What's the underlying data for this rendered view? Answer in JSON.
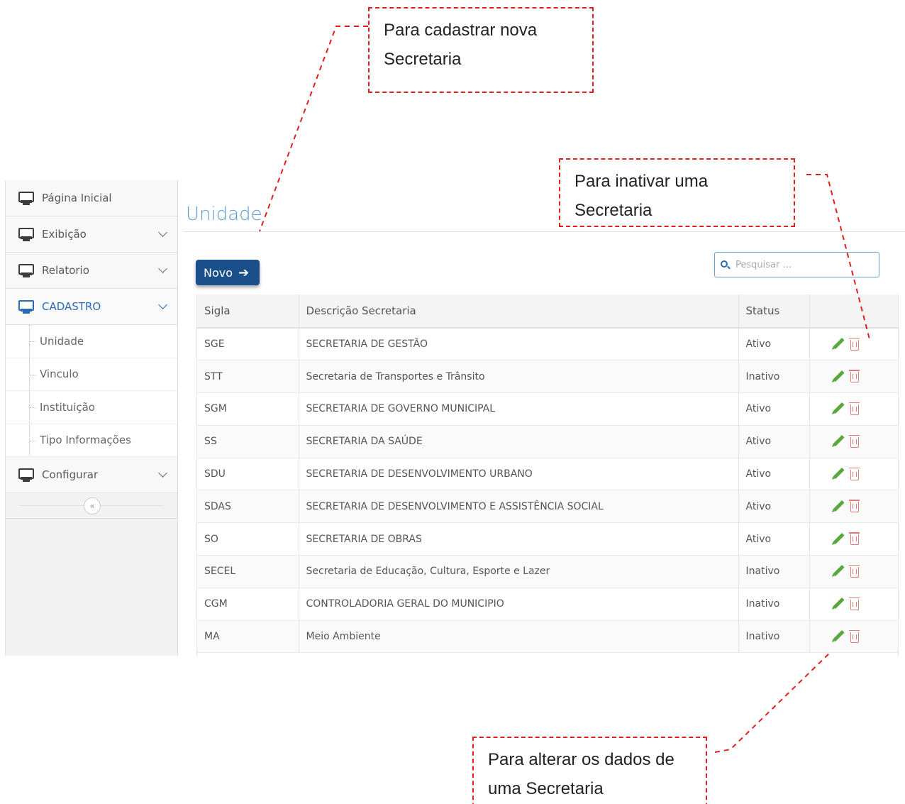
{
  "sidebar": {
    "items": [
      {
        "label": "Página Inicial"
      },
      {
        "label": "Exibição"
      },
      {
        "label": "Relatorio"
      },
      {
        "label": "CADASTRO"
      },
      {
        "label": "Configurar"
      }
    ],
    "submenu": [
      {
        "label": "Unidade"
      },
      {
        "label": "Vinculo"
      },
      {
        "label": "Instituição"
      },
      {
        "label": "Tipo Informações"
      }
    ],
    "collapse_glyph": "«"
  },
  "main": {
    "title": "Unidade",
    "new_button": "Novo",
    "search_placeholder": "Pesquisar ..."
  },
  "table": {
    "headers": [
      "Sigla",
      "Descrição Secretaria",
      "Status",
      ""
    ],
    "rows": [
      {
        "sigla": "SGE",
        "descricao": "SECRETARIA DE GESTÃO",
        "status": "Ativo"
      },
      {
        "sigla": "STT",
        "descricao": "Secretaria de Transportes e Trânsito",
        "status": "Inativo"
      },
      {
        "sigla": "SGM",
        "descricao": "SECRETARIA DE GOVERNO MUNICIPAL",
        "status": "Ativo"
      },
      {
        "sigla": "SS",
        "descricao": "SECRETARIA DA SAÚDE",
        "status": "Ativo"
      },
      {
        "sigla": "SDU",
        "descricao": "SECRETARIA DE DESENVOLVIMENTO URBANO",
        "status": "Ativo"
      },
      {
        "sigla": "SDAS",
        "descricao": "SECRETARIA DE DESENVOLVIMENTO E ASSISTÊNCIA SOCIAL",
        "status": "Ativo"
      },
      {
        "sigla": "SO",
        "descricao": "SECRETARIA DE OBRAS",
        "status": "Ativo"
      },
      {
        "sigla": "SECEL",
        "descricao": "Secretaria de Educação, Cultura, Esporte e Lazer",
        "status": "Inativo"
      },
      {
        "sigla": "CGM",
        "descricao": "CONTROLADORIA GERAL DO MUNICIPIO",
        "status": "Inativo"
      },
      {
        "sigla": "MA",
        "descricao": "Meio Ambiente",
        "status": "Inativo"
      }
    ]
  },
  "callouts": {
    "new": {
      "line1": "Para cadastrar nova",
      "line2": "Secretaria"
    },
    "inactivate": {
      "line1": "Para inativar uma",
      "line2": "Secretaria"
    },
    "edit": {
      "line1": "Para alterar os dados de",
      "line2": "uma Secretaria"
    }
  },
  "colors": {
    "accent": "#2a6cb6",
    "button": "#1b4f8c",
    "title": "#5b9bd5",
    "edit_icon": "#58a83e",
    "delete_icon": "#e27a7a",
    "callout_border": "#e0201e"
  },
  "icons": {
    "nav": "monitor-icon",
    "expand": "chevron-down-icon",
    "search": "search-icon",
    "edit": "pencil-icon",
    "delete": "trash-icon",
    "new_arrow": "arrow-right-icon"
  }
}
